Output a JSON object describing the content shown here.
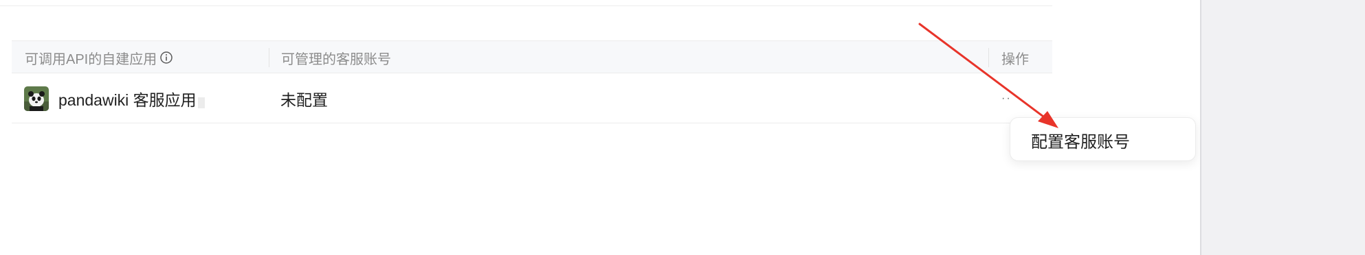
{
  "table": {
    "columns": {
      "app": "可调用API的自建应用",
      "accounts": "可管理的客服账号",
      "actions": "操作"
    },
    "rows": [
      {
        "app_name": "pandawiki 客服应用",
        "account_status": "未配置",
        "actions_label": "··"
      }
    ]
  },
  "dropdown": {
    "items": [
      "配置客服账号"
    ]
  },
  "icons": {
    "info": "info-circle-icon",
    "avatar": "panda-avatar-image",
    "more": "more-dots-icon"
  },
  "colors": {
    "annotation_arrow": "#e8342a",
    "header_bg": "#f7f8fa",
    "side_panel": "#f1f1f3"
  }
}
